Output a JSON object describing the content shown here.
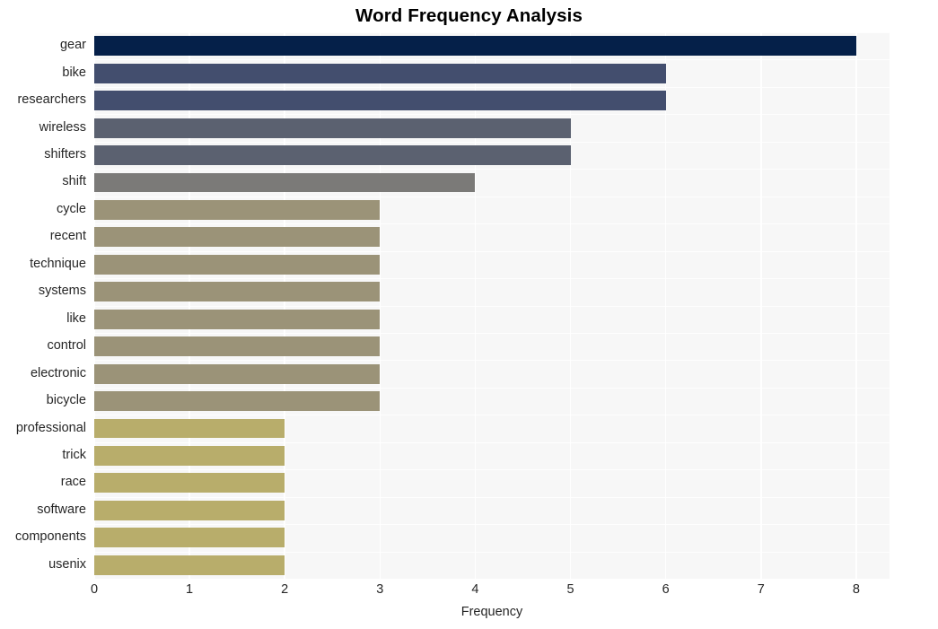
{
  "chart_data": {
    "type": "bar",
    "orientation": "horizontal",
    "title": "Word Frequency Analysis",
    "xlabel": "Frequency",
    "ylabel": "",
    "xlim": [
      0,
      8.35
    ],
    "xticks": [
      0,
      1,
      2,
      3,
      4,
      5,
      6,
      7,
      8
    ],
    "xticklabels": [
      "0",
      "1",
      "2",
      "3",
      "4",
      "5",
      "6",
      "7",
      "8"
    ],
    "grid": true,
    "legend": false,
    "categories": [
      "gear",
      "bike",
      "researchers",
      "wireless",
      "shifters",
      "shift",
      "cycle",
      "recent",
      "technique",
      "systems",
      "like",
      "control",
      "electronic",
      "bicycle",
      "professional",
      "trick",
      "race",
      "software",
      "components",
      "usenix"
    ],
    "values": [
      8,
      6,
      6,
      5,
      5,
      4,
      3,
      3,
      3,
      3,
      3,
      3,
      3,
      3,
      2,
      2,
      2,
      2,
      2,
      2
    ],
    "bar_colors": [
      "#052049",
      "#434e6e",
      "#434e6e",
      "#5b6170",
      "#5b6170",
      "#7b7a78",
      "#9b9378",
      "#9b9378",
      "#9b9378",
      "#9b9378",
      "#9b9378",
      "#9b9378",
      "#9b9378",
      "#9b9378",
      "#b8ad6b",
      "#b8ad6b",
      "#b8ad6b",
      "#b8ad6b",
      "#b8ad6b",
      "#b8ad6b"
    ],
    "plot_background": "#f7f7f7",
    "figure_background": "#ffffff",
    "gridline_color": "#ffffff",
    "text_color": "#262626"
  }
}
